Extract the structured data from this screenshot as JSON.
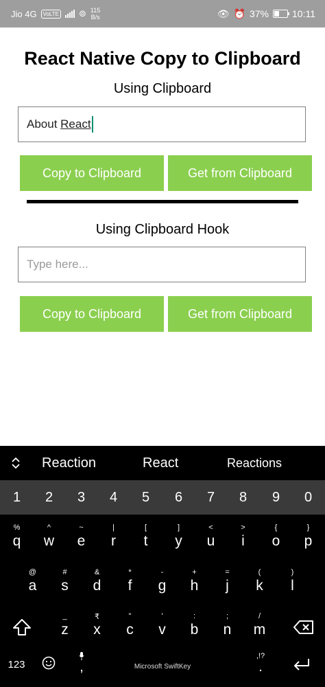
{
  "status_bar": {
    "carrier": "Jio 4G",
    "volte": "VoLTE",
    "speed_value": "115",
    "speed_unit": "B/s",
    "battery": "37%",
    "time": "10:11"
  },
  "app": {
    "title": "React Native Copy to Clipboard",
    "section1": {
      "heading": "Using Clipboard",
      "input_value_plain": "About ",
      "input_value_underlined": "React",
      "copy_label": "Copy to Clipboard",
      "get_label": "Get from Clipboard"
    },
    "section2": {
      "heading": "Using Clipboard Hook",
      "placeholder": "Type here...",
      "copy_label": "Copy to Clipboard",
      "get_label": "Get from Clipboard"
    }
  },
  "keyboard": {
    "suggestions": [
      "Reaction",
      "React",
      "Reactions"
    ],
    "numbers": [
      "1",
      "2",
      "3",
      "4",
      "5",
      "6",
      "7",
      "8",
      "9",
      "0"
    ],
    "row1": [
      {
        "main": "q",
        "alt": "%"
      },
      {
        "main": "w",
        "alt": "^"
      },
      {
        "main": "e",
        "alt": "~"
      },
      {
        "main": "r",
        "alt": "|"
      },
      {
        "main": "t",
        "alt": "["
      },
      {
        "main": "y",
        "alt": "]"
      },
      {
        "main": "u",
        "alt": "<"
      },
      {
        "main": "i",
        "alt": ">"
      },
      {
        "main": "o",
        "alt": "{"
      },
      {
        "main": "p",
        "alt": "}"
      }
    ],
    "row2": [
      {
        "main": "a",
        "alt": "@"
      },
      {
        "main": "s",
        "alt": "#"
      },
      {
        "main": "d",
        "alt": "&"
      },
      {
        "main": "f",
        "alt": "*"
      },
      {
        "main": "g",
        "alt": "-"
      },
      {
        "main": "h",
        "alt": "+"
      },
      {
        "main": "j",
        "alt": "="
      },
      {
        "main": "k",
        "alt": "("
      },
      {
        "main": "l",
        "alt": ")"
      }
    ],
    "row3": [
      {
        "main": "z",
        "alt": "_"
      },
      {
        "main": "x",
        "alt": "₹"
      },
      {
        "main": "c",
        "alt": "\""
      },
      {
        "main": "v",
        "alt": "'"
      },
      {
        "main": "b",
        "alt": ":"
      },
      {
        "main": "n",
        "alt": ";"
      },
      {
        "main": "m",
        "alt": "/"
      }
    ],
    "symbols_key": "123",
    "period_key": ".",
    "period_alt": ",!?",
    "comma_key": ",",
    "brand": "Microsoft SwiftKey"
  },
  "colors": {
    "button": "#8bcf4f",
    "status_bar": "#9e9e9e",
    "keyboard_bg": "#000000",
    "number_row": "#3a3a3a",
    "cursor": "#0a8f6f"
  }
}
